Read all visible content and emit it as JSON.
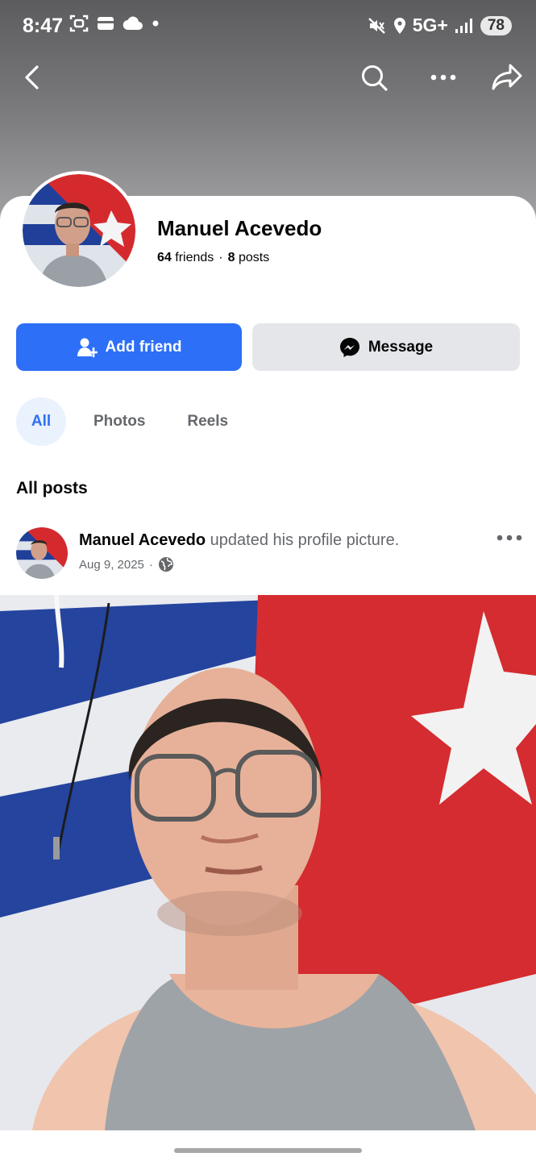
{
  "status_bar": {
    "time": "8:47",
    "network": "5G+",
    "battery": "78"
  },
  "profile": {
    "name": "Manuel Acevedo",
    "friends_count": "64",
    "friends_label": "friends",
    "separator": "·",
    "posts_count": "8",
    "posts_label": "posts"
  },
  "actions": {
    "add_friend_label": "Add friend",
    "message_label": "Message"
  },
  "tabs": [
    {
      "label": "All",
      "active": true
    },
    {
      "label": "Photos",
      "active": false
    },
    {
      "label": "Reels",
      "active": false
    }
  ],
  "section_title": "All posts",
  "post": {
    "author": "Manuel Acevedo",
    "action_text": "updated his profile picture.",
    "date": "Aug 9, 2025",
    "meta_separator": "·"
  },
  "icons": {
    "back": "chevron-left-icon",
    "search": "search-icon",
    "more": "more-dots-icon",
    "share": "share-icon",
    "add_friend": "add-person-icon",
    "messenger": "messenger-icon",
    "privacy": "globe-icon"
  },
  "colors": {
    "brand_blue": "#2d6ff7",
    "secondary_button": "#e4e6ea",
    "active_tab_bg": "#eaf2fd",
    "muted_text": "#65676b"
  }
}
